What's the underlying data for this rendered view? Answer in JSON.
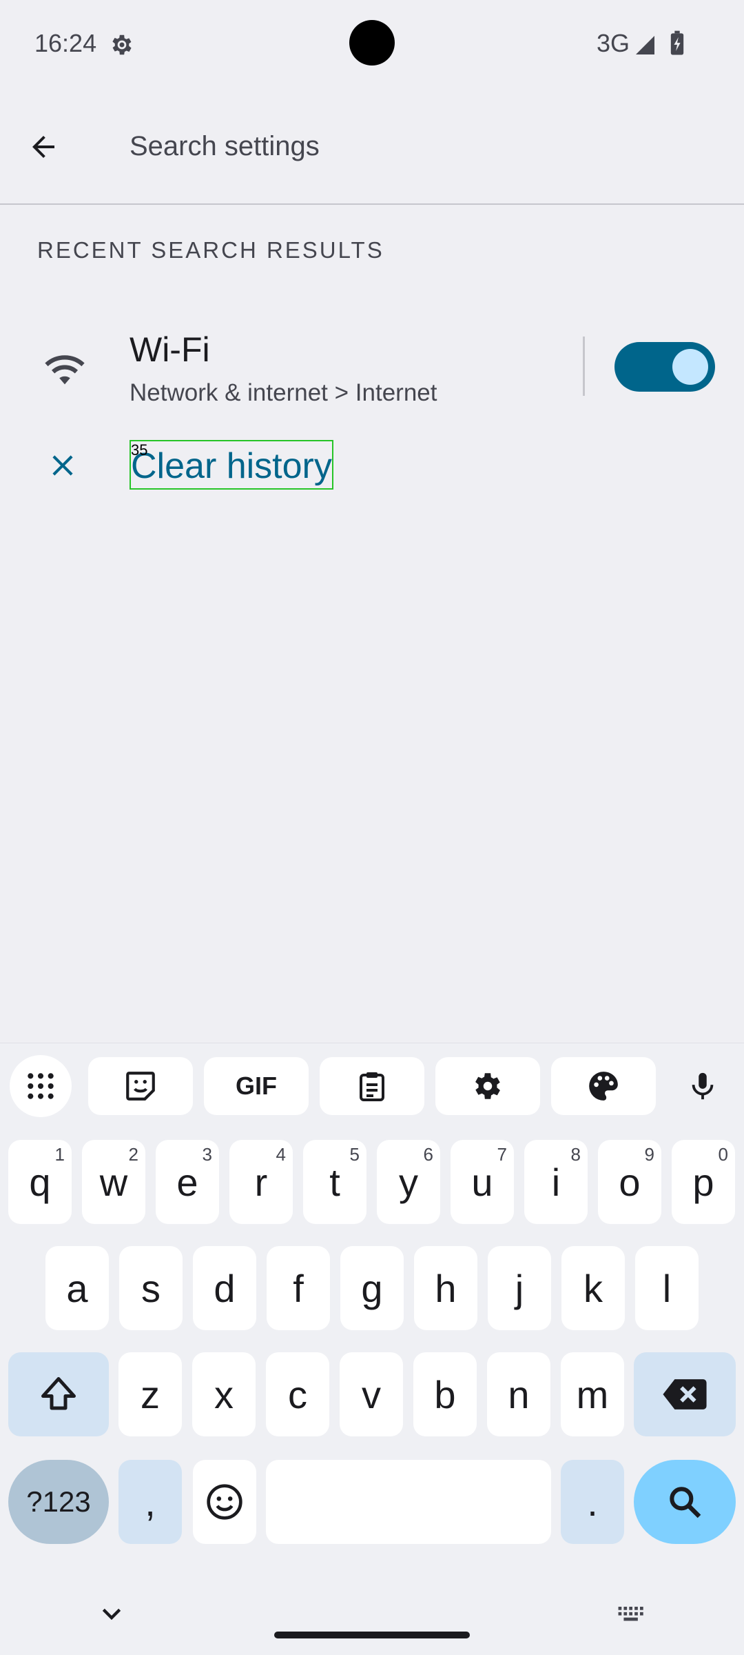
{
  "status_bar": {
    "time": "16:24",
    "network": "3G"
  },
  "search": {
    "placeholder": "Search settings"
  },
  "section": {
    "title": "RECENT SEARCH RESULTS"
  },
  "result": {
    "title": "Wi-Fi",
    "subtitle": "Network & internet > Internet",
    "toggle_on": true
  },
  "clear": {
    "label": "Clear history",
    "tag": "35"
  },
  "colors": {
    "accent": "#00658b",
    "toggle_knob": "#c4e7ff",
    "highlight_box": "#27c427"
  },
  "keyboard": {
    "toolbar": [
      "apps-grid-icon",
      "sticker-icon",
      "GIF",
      "clipboard-icon",
      "settings-icon",
      "palette-icon",
      "mic-icon"
    ],
    "gif_label": "GIF",
    "row1": [
      {
        "k": "q",
        "h": "1"
      },
      {
        "k": "w",
        "h": "2"
      },
      {
        "k": "e",
        "h": "3"
      },
      {
        "k": "r",
        "h": "4"
      },
      {
        "k": "t",
        "h": "5"
      },
      {
        "k": "y",
        "h": "6"
      },
      {
        "k": "u",
        "h": "7"
      },
      {
        "k": "i",
        "h": "8"
      },
      {
        "k": "o",
        "h": "9"
      },
      {
        "k": "p",
        "h": "0"
      }
    ],
    "row2": [
      "a",
      "s",
      "d",
      "f",
      "g",
      "h",
      "j",
      "k",
      "l"
    ],
    "row3": [
      "z",
      "x",
      "c",
      "v",
      "b",
      "n",
      "m"
    ],
    "sym_label": "?123",
    "comma": ",",
    "period": "."
  }
}
